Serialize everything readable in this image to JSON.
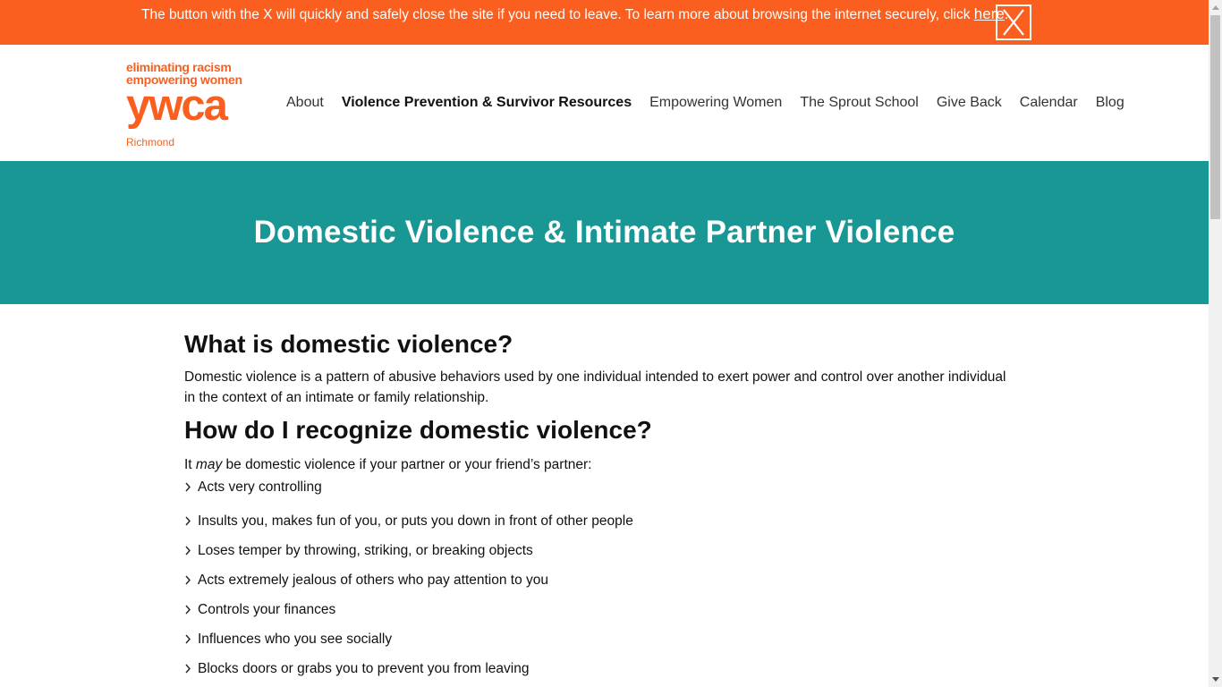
{
  "alert": {
    "text": "The button with the X will quickly and safely close the site if you need to leave. To learn more about browsing the internet securely, click ",
    "link_text": "here",
    "end": ".",
    "close_label": "X"
  },
  "logo": {
    "line1": "eliminating racism",
    "line2": "empowering women",
    "brand": "ywca",
    "city": "Richmond"
  },
  "nav": {
    "items": [
      {
        "label": "About"
      },
      {
        "label": "Violence Prevention & Survivor Resources"
      },
      {
        "label": "Empowering Women"
      },
      {
        "label": "The Sprout School"
      },
      {
        "label": "Give Back"
      },
      {
        "label": "Calendar"
      },
      {
        "label": "Blog"
      }
    ],
    "active_index": 1
  },
  "hero": {
    "title": "Domestic Violence & Intimate Partner Violence"
  },
  "content": {
    "heading1": "What is domestic violence?",
    "para1": "Domestic violence is a pattern of abusive behaviors used by one individual intended to exert power and control over another individual in the context of an intimate or family relationship.",
    "heading2": "How do I recognize domestic violence?",
    "intro_before": "It ",
    "intro_em": "may",
    "intro_after": " be domestic violence if your partner or your friend’s partner:",
    "list": [
      "Acts very controlling",
      "Insults you, makes fun of you, or puts you down in front of other people",
      "Loses temper by throwing, striking, or breaking objects",
      "Acts extremely jealous of others who pay attention to you",
      "Controls your finances",
      "Influences who you see socially",
      "Blocks doors or grabs you to prevent you from leaving"
    ]
  },
  "colors": {
    "alert_bg": "#fa5f1f",
    "brand_orange": "#fa5f1f",
    "hero_bg": "#189795"
  },
  "icons": {
    "close": "close-x-icon",
    "bullet": "chevron-right-icon",
    "scroll_up": "arrow-up-icon",
    "scroll_down": "arrow-down-icon"
  },
  "scroll": {
    "position": 0
  }
}
